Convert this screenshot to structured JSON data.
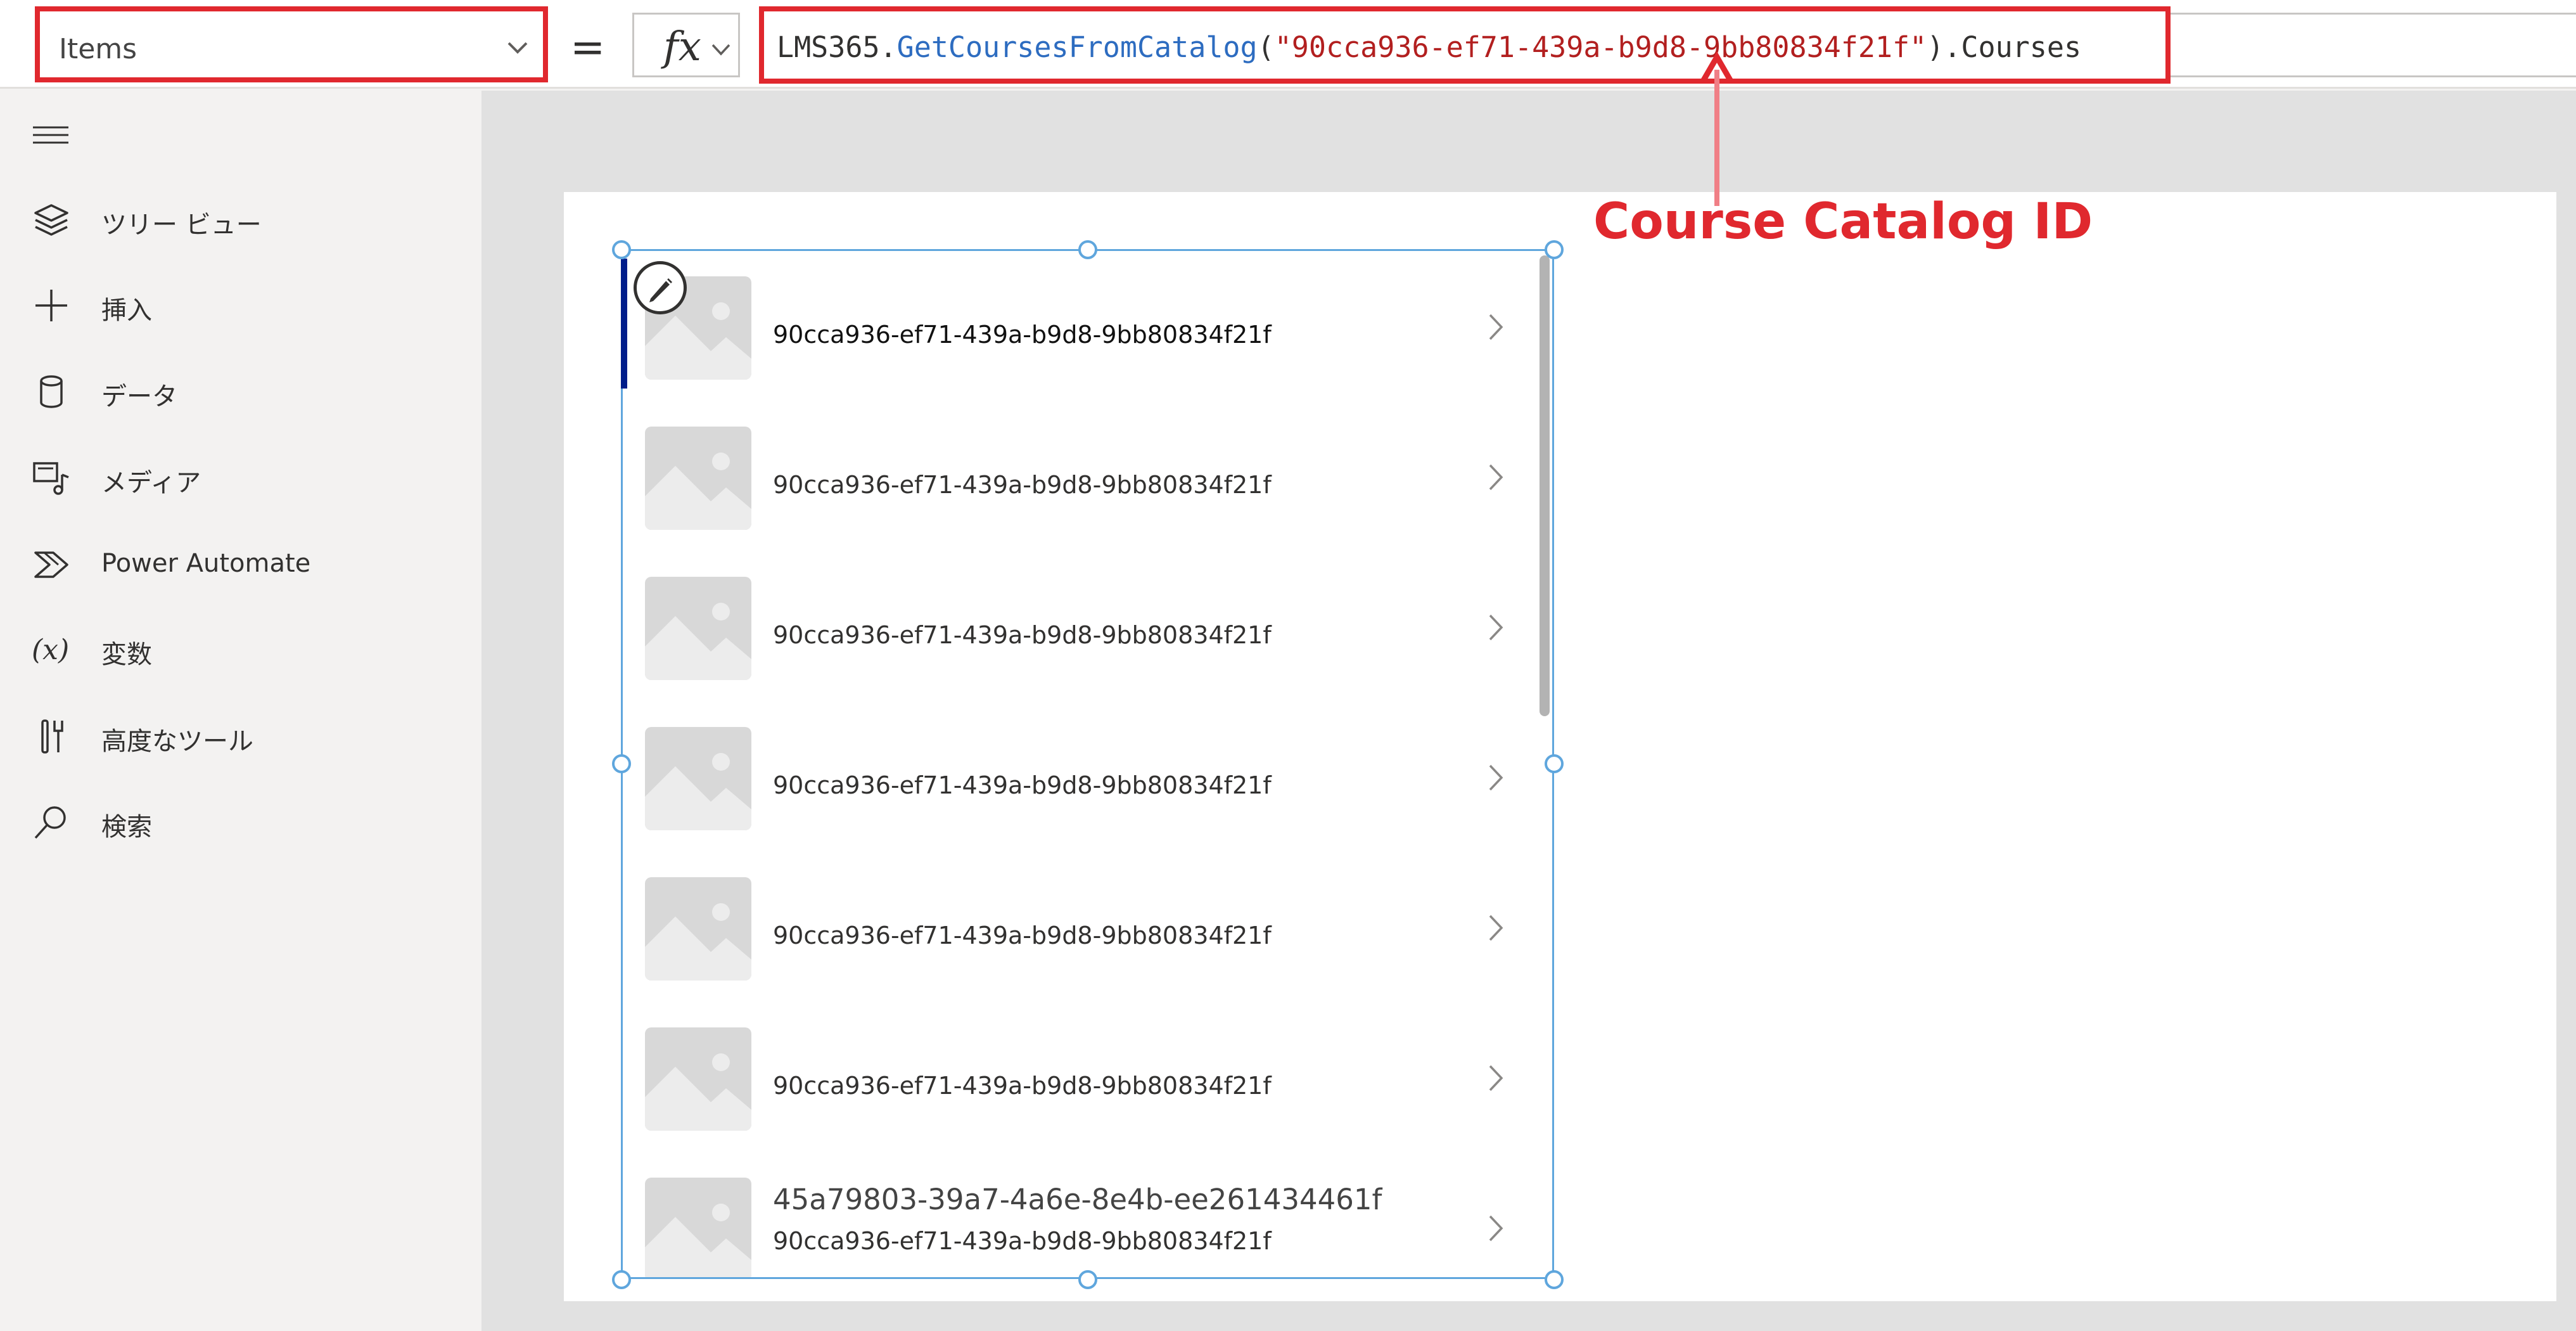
{
  "formula_bar": {
    "property": "Items",
    "equals": "=",
    "fx_label": "fx",
    "formula": {
      "object": "LMS365.",
      "function": "GetCoursesFromCatalog",
      "open": "(",
      "string": "\"90cca936-ef71-439a-b9d8-9bb80834f21f\"",
      "close": ").Courses"
    }
  },
  "sidebar": {
    "menu_icon": "hamburger-icon",
    "items": [
      {
        "label": "ツリー ビュー",
        "icon": "layers-icon"
      },
      {
        "label": "挿入",
        "icon": "plus-icon"
      },
      {
        "label": "データ",
        "icon": "database-icon"
      },
      {
        "label": "メディア",
        "icon": "media-icon"
      },
      {
        "label": "Power Automate",
        "icon": "power-automate-icon"
      },
      {
        "label": "変数",
        "icon": "variable-icon"
      },
      {
        "label": "高度なツール",
        "icon": "tools-icon"
      },
      {
        "label": "検索",
        "icon": "search-icon"
      }
    ]
  },
  "gallery": {
    "rows": [
      {
        "title": "90cca936-ef71-439a-b9d8-9bb80834f21f"
      },
      {
        "title": "90cca936-ef71-439a-b9d8-9bb80834f21f"
      },
      {
        "title": "90cca936-ef71-439a-b9d8-9bb80834f21f"
      },
      {
        "title": "90cca936-ef71-439a-b9d8-9bb80834f21f"
      },
      {
        "title": "90cca936-ef71-439a-b9d8-9bb80834f21f"
      },
      {
        "title": "90cca936-ef71-439a-b9d8-9bb80834f21f"
      },
      {
        "heading": "45a79803-39a7-4a6e-8e4b-ee261434461f",
        "title": "90cca936-ef71-439a-b9d8-9bb80834f21f"
      }
    ]
  },
  "annotation": {
    "label": "Course Catalog ID",
    "color": "#e0282e"
  },
  "colors": {
    "highlight_border": "#e0282e",
    "selection_border": "#5fa6dd",
    "selected_row_bar": "#001d8a",
    "function_token": "#2d6cc0",
    "string_token": "#b21f1f"
  }
}
